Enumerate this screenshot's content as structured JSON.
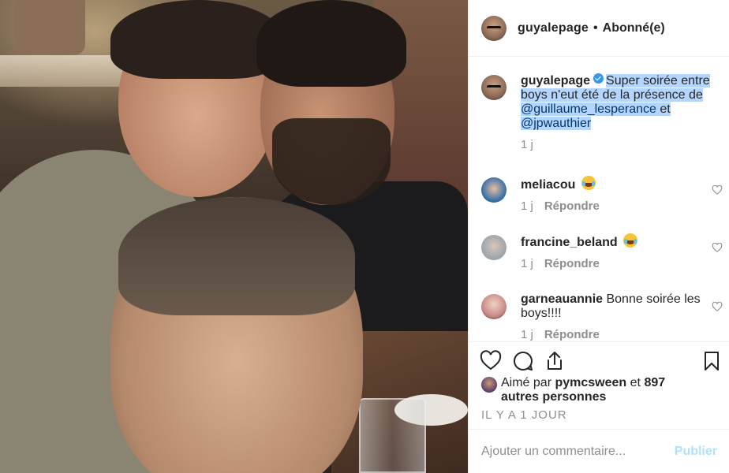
{
  "header": {
    "username": "guyalepage",
    "separator": "•",
    "follow_status": "Abonné(e)"
  },
  "caption": {
    "username": "guyalepage",
    "verified": true,
    "text_before": "Super soirée entre boys n'eut été de la présence de ",
    "mention_1": "@guillaume_lesperance",
    "text_mid": " et ",
    "mention_2": "@jpwauthier",
    "time": "1 j"
  },
  "comments": [
    {
      "username": "meliacou",
      "text": "",
      "emoji": "tears-of-joy",
      "time": "1 j",
      "reply_label": "Répondre"
    },
    {
      "username": "francine_beland",
      "text": "",
      "emoji": "tears-of-joy",
      "time": "1 j",
      "reply_label": "Répondre"
    },
    {
      "username": "garneauannie",
      "text": "Bonne soirée les boys!!!!",
      "emoji": "",
      "time": "1 j",
      "reply_label": "Répondre"
    }
  ],
  "actions": {
    "like_icon": "heart-icon",
    "comment_icon": "comment-icon",
    "share_icon": "share-icon",
    "save_icon": "bookmark-icon"
  },
  "likes": {
    "prefix": "Aimé par ",
    "user": "pymcsween",
    "conjunction": " et",
    "others": "897 autres personnes"
  },
  "time_ago": "Il y a 1 jour",
  "add_comment": {
    "placeholder": "Ajouter un commentaire...",
    "post_label": "Publier"
  },
  "colors": {
    "verified": "#3897f0",
    "mention": "#00376b",
    "selection": "#b4d5fe",
    "post_disabled": "#b2dffc",
    "muted": "#8e8e8e"
  }
}
